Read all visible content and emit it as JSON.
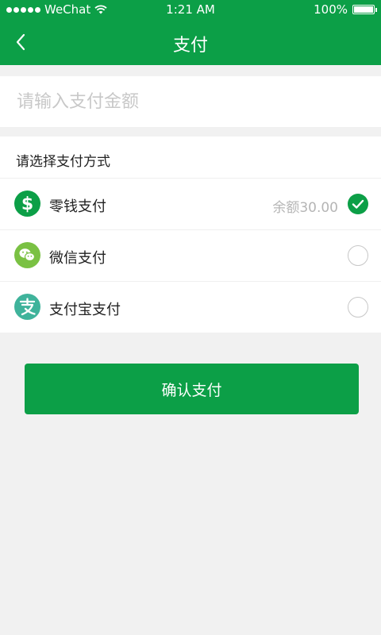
{
  "status_bar": {
    "carrier": "WeChat",
    "time": "1:21 AM",
    "battery": "100%"
  },
  "nav": {
    "title": "支付"
  },
  "amount": {
    "placeholder": "请输入支付金额",
    "value": ""
  },
  "payment_section": {
    "title": "请选择支付方式",
    "methods": [
      {
        "label": "零钱支付",
        "balance": "余额30.00",
        "selected": true,
        "icon": "dollar-icon",
        "icon_color": "#0c9f47"
      },
      {
        "label": "微信支付",
        "balance": "",
        "selected": false,
        "icon": "wechat-icon",
        "icon_color": "#7ac143"
      },
      {
        "label": "支付宝支付",
        "balance": "",
        "selected": false,
        "icon": "alipay-icon",
        "icon_color": "#3fb39b"
      }
    ]
  },
  "confirm_button": {
    "label": "确认支付"
  },
  "colors": {
    "primary": "#0c9f47",
    "background": "#f1f1f1"
  }
}
